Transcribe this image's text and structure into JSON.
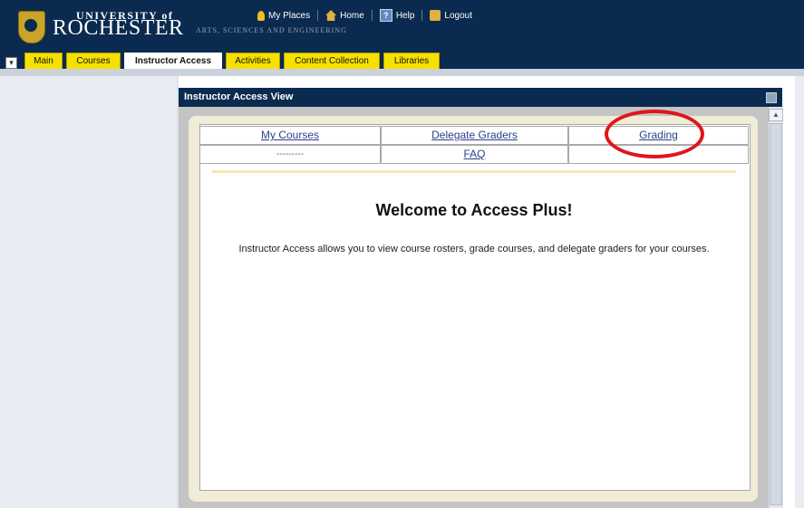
{
  "header": {
    "university_prefix": "UNIVERSITY of",
    "university_name": "ROCHESTER",
    "subtitle": "ARTS, SCIENCES AND ENGINEERING",
    "links": [
      {
        "label": "My Places"
      },
      {
        "label": "Home"
      },
      {
        "label": "Help"
      },
      {
        "label": "Logout"
      }
    ]
  },
  "tabs": [
    {
      "label": "Main"
    },
    {
      "label": "Courses"
    },
    {
      "label": "Instructor Access",
      "active": true
    },
    {
      "label": "Activities"
    },
    {
      "label": "Content Collection"
    },
    {
      "label": "Libraries"
    }
  ],
  "portlet": {
    "title": "Instructor Access View",
    "nav_row1": [
      "My Courses",
      "Delegate Graders",
      "Grading"
    ],
    "nav_row2": [
      "---------",
      "FAQ",
      ""
    ],
    "welcome": "Welcome to Access Plus!",
    "description": "Instructor Access allows you to view course rosters, grade courses, and delegate graders for your courses."
  },
  "colors": {
    "header_bg": "#0b2a4f",
    "tab_bg": "#f5e100",
    "highlight": "#e0151a"
  }
}
